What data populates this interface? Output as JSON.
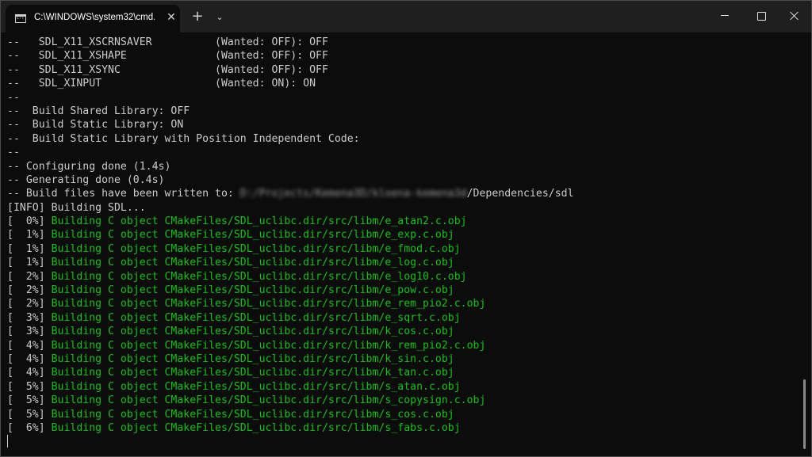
{
  "window": {
    "tab_title": "C:\\WINDOWS\\system32\\cmd.",
    "tab_close": "✕",
    "new_tab": "+",
    "dropdown": "⌄"
  },
  "terminal": {
    "lines": [
      {
        "text": "--   SDL_X11_XSCRNSAVER          (Wanted: OFF): OFF"
      },
      {
        "text": "--   SDL_X11_XSHAPE              (Wanted: OFF): OFF"
      },
      {
        "text": "--   SDL_X11_XSYNC               (Wanted: OFF): OFF"
      },
      {
        "text": "--   SDL_XINPUT                  (Wanted: ON): ON"
      },
      {
        "text": "--"
      },
      {
        "text": "--  Build Shared Library: OFF"
      },
      {
        "text": "--  Build Static Library: ON"
      },
      {
        "text": "--  Build Static Library with Position Independent Code: "
      },
      {
        "text": "--"
      },
      {
        "text": "-- Configuring done (1.4s)"
      },
      {
        "text": "-- Generating done (0.4s)"
      },
      {
        "text": "-- Build files have been written to: ",
        "blurred": "D:/Projects/Kemena3D/kloena-kemena3d",
        "suffix": "/Dependencies/sdl"
      },
      {
        "text": "[INFO] Building SDL..."
      },
      {
        "prefix": "[  0%] ",
        "text": "Building C object CMakeFiles/SDL_uclibc.dir/src/libm/e_atan2.c.obj"
      },
      {
        "prefix": "[  1%] ",
        "text": "Building C object CMakeFiles/SDL_uclibc.dir/src/libm/e_exp.c.obj"
      },
      {
        "prefix": "[  1%] ",
        "text": "Building C object CMakeFiles/SDL_uclibc.dir/src/libm/e_fmod.c.obj"
      },
      {
        "prefix": "[  1%] ",
        "text": "Building C object CMakeFiles/SDL_uclibc.dir/src/libm/e_log.c.obj"
      },
      {
        "prefix": "[  2%] ",
        "text": "Building C object CMakeFiles/SDL_uclibc.dir/src/libm/e_log10.c.obj"
      },
      {
        "prefix": "[  2%] ",
        "text": "Building C object CMakeFiles/SDL_uclibc.dir/src/libm/e_pow.c.obj"
      },
      {
        "prefix": "[  2%] ",
        "text": "Building C object CMakeFiles/SDL_uclibc.dir/src/libm/e_rem_pio2.c.obj"
      },
      {
        "prefix": "[  3%] ",
        "text": "Building C object CMakeFiles/SDL_uclibc.dir/src/libm/e_sqrt.c.obj"
      },
      {
        "prefix": "[  3%] ",
        "text": "Building C object CMakeFiles/SDL_uclibc.dir/src/libm/k_cos.c.obj"
      },
      {
        "prefix": "[  4%] ",
        "text": "Building C object CMakeFiles/SDL_uclibc.dir/src/libm/k_rem_pio2.c.obj"
      },
      {
        "prefix": "[  4%] ",
        "text": "Building C object CMakeFiles/SDL_uclibc.dir/src/libm/k_sin.c.obj"
      },
      {
        "prefix": "[  4%] ",
        "text": "Building C object CMakeFiles/SDL_uclibc.dir/src/libm/k_tan.c.obj"
      },
      {
        "prefix": "[  5%] ",
        "text": "Building C object CMakeFiles/SDL_uclibc.dir/src/libm/s_atan.c.obj"
      },
      {
        "prefix": "[  5%] ",
        "text": "Building C object CMakeFiles/SDL_uclibc.dir/src/libm/s_copysign.c.obj"
      },
      {
        "prefix": "[  5%] ",
        "text": "Building C object CMakeFiles/SDL_uclibc.dir/src/libm/s_cos.c.obj"
      },
      {
        "prefix": "[  6%] ",
        "text": "Building C object CMakeFiles/SDL_uclibc.dir/src/libm/s_fabs.c.obj"
      }
    ]
  },
  "colors": {
    "background": "#0c0c0c",
    "titlebar": "#1f1f1f",
    "text": "#cccccc",
    "build_green": "#13c213"
  }
}
